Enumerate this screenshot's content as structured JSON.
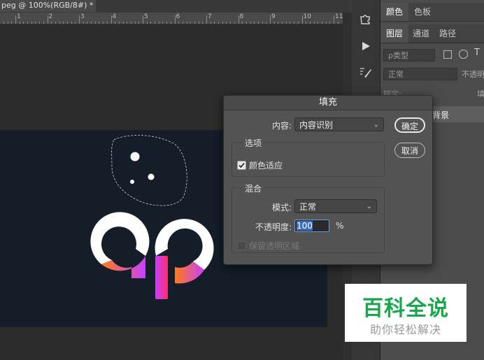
{
  "document": {
    "tab_title": "peg @ 100%(RGB/8#) *"
  },
  "ruler": {
    "marks": [
      "1",
      "2",
      "3",
      "4",
      "5",
      "6",
      "7",
      "8",
      "9",
      "10",
      "11"
    ]
  },
  "panels": {
    "top_tabs": [
      "颜色",
      "色板"
    ],
    "layer_tabs": [
      "图层",
      "通道",
      "路径"
    ],
    "kind_filter": "ρ类型",
    "blend_mode": "正常",
    "opacity_label": "不透明",
    "lock_label": "锁定:",
    "fill_label": "填",
    "layer_name": "背景"
  },
  "fill_dialog": {
    "title": "填充",
    "contents_label": "内容:",
    "contents_value": "内容识别",
    "options_group": "选项",
    "color_adaptation_label": "颜色适应",
    "color_adaptation_checked": true,
    "blending_group": "混合",
    "mode_label": "模式:",
    "mode_value": "正常",
    "opacity_label": "不透明度:",
    "opacity_value": "100",
    "opacity_unit": "%",
    "preserve_transparency_label": "保留透明区域",
    "preserve_transparency_checked": false,
    "ok_label": "确定",
    "cancel_label": "取消"
  },
  "watermark": {
    "title": "百科全说",
    "subtitle": "助你轻松解决"
  },
  "colors": {
    "artboard": "#141d28",
    "logo_white": "#ffffff",
    "logo_gradient_start": "#ff7a1a",
    "logo_gradient_end": "#c640ff",
    "watermark_green": "#17a84b"
  },
  "icons": [
    "puzzle-icon",
    "play-icon",
    "brush-settings-icon",
    "checkmark-icon",
    "chevron-down-icon"
  ]
}
